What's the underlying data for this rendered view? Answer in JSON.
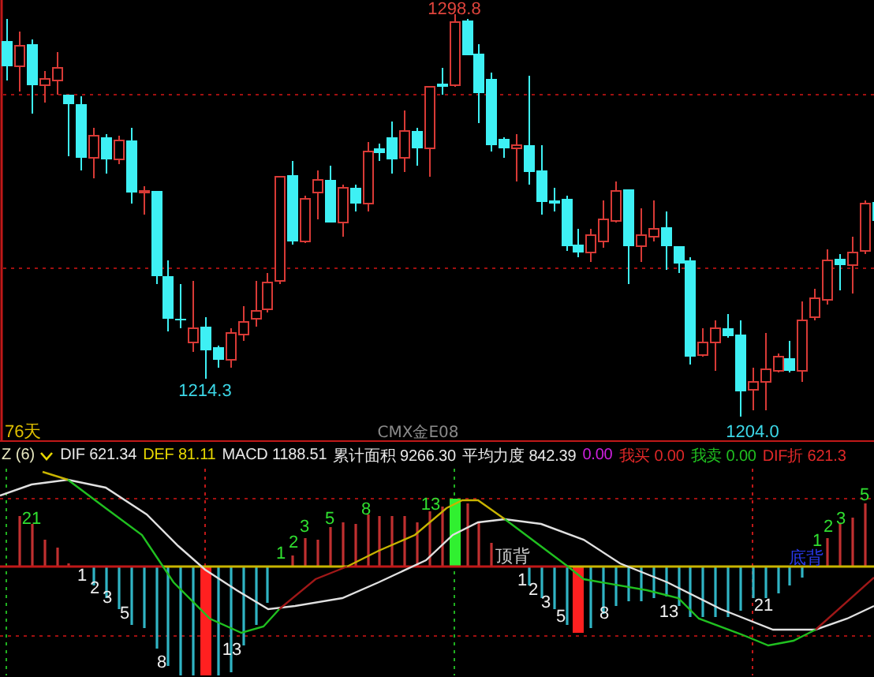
{
  "price_chart": {
    "price_labels": [
      {
        "text": "1298.8",
        "color": "#e0443c"
      },
      {
        "text": "1214.3",
        "color": "#3cd8e8"
      },
      {
        "text": "1204.0",
        "color": "#3cd8e8"
      }
    ],
    "period_label": "76天",
    "symbol": "CMX金E08"
  },
  "indicator": {
    "title": "Z (6)",
    "readings": [
      {
        "text": "DIF 621.34",
        "color": "#e8e8e8"
      },
      {
        "text": "DEF 81.11",
        "color": "#e8d800"
      },
      {
        "text": "MACD 1188.51",
        "color": "#e8e8e8"
      },
      {
        "text": "累计面积 9266.30",
        "color": "#e8e8e8"
      },
      {
        "text": "平均力度 842.39",
        "color": "#e8e8e8"
      },
      {
        "text": "0.00",
        "color": "#d020e0"
      },
      {
        "text": "我买 0.00",
        "color": "#e02828"
      },
      {
        "text": "我卖 0.00",
        "color": "#20c020"
      },
      {
        "text": "DIF折 621.3",
        "color": "#e02828"
      }
    ],
    "counts": [
      {
        "text": "21",
        "color": "#30e030"
      },
      {
        "text": "1",
        "color": "#f0f0f0"
      },
      {
        "text": "2",
        "color": "#f0f0f0"
      },
      {
        "text": "3",
        "color": "#f0f0f0"
      },
      {
        "text": "5",
        "color": "#f0f0f0"
      },
      {
        "text": "8",
        "color": "#f0f0f0"
      },
      {
        "text": "13",
        "color": "#f0f0f0"
      },
      {
        "text": "1",
        "color": "#30e030"
      },
      {
        "text": "2",
        "color": "#30e030"
      },
      {
        "text": "3",
        "color": "#30e030"
      },
      {
        "text": "5",
        "color": "#30e030"
      },
      {
        "text": "8",
        "color": "#30e030"
      },
      {
        "text": "13",
        "color": "#30e030"
      },
      {
        "text": "顶背",
        "color": "#c8c8c8"
      },
      {
        "text": "1",
        "color": "#f0f0f0"
      },
      {
        "text": "2",
        "color": "#f0f0f0"
      },
      {
        "text": "3",
        "color": "#f0f0f0"
      },
      {
        "text": "5",
        "color": "#f0f0f0"
      },
      {
        "text": "8",
        "color": "#f0f0f0"
      },
      {
        "text": "13",
        "color": "#f0f0f0"
      },
      {
        "text": "21",
        "color": "#f0f0f0"
      },
      {
        "text": "底背",
        "color": "#2838e8"
      },
      {
        "text": "1",
        "color": "#30e030"
      },
      {
        "text": "2",
        "color": "#30e030"
      },
      {
        "text": "3",
        "color": "#30e030"
      },
      {
        "text": "5",
        "color": "#30e030"
      }
    ]
  }
}
